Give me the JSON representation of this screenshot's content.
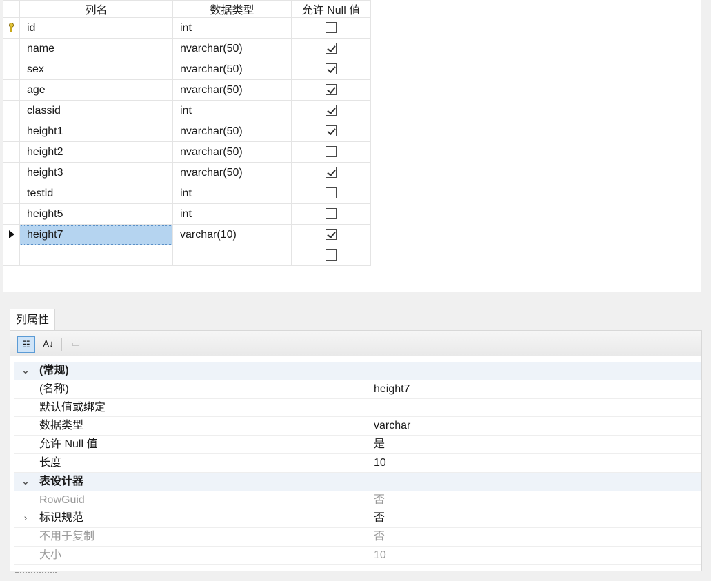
{
  "grid": {
    "headers": {
      "name": "列名",
      "type": "数据类型",
      "null": "允许 Null 值"
    },
    "rows": [
      {
        "name": "id",
        "type": "int",
        "allow_null": false,
        "pk": true
      },
      {
        "name": "name",
        "type": "nvarchar(50)",
        "allow_null": true
      },
      {
        "name": "sex",
        "type": "nvarchar(50)",
        "allow_null": true
      },
      {
        "name": "age",
        "type": "nvarchar(50)",
        "allow_null": true
      },
      {
        "name": "classid",
        "type": "int",
        "allow_null": true
      },
      {
        "name": "height1",
        "type": "nvarchar(50)",
        "allow_null": true
      },
      {
        "name": "height2",
        "type": "nvarchar(50)",
        "allow_null": false
      },
      {
        "name": "height3",
        "type": "nvarchar(50)",
        "allow_null": true
      },
      {
        "name": "testid",
        "type": "int",
        "allow_null": false
      },
      {
        "name": "height5",
        "type": "int",
        "allow_null": false
      },
      {
        "name": "height7",
        "type": "varchar(10)",
        "allow_null": true,
        "current": true
      },
      {
        "name": "",
        "type": "",
        "allow_null": false
      }
    ]
  },
  "props": {
    "tab_label": "列属性",
    "toolbar": {
      "categorized_icon": "categorized-icon",
      "alpha_icon": "sort-az-icon",
      "pages_icon": "property-pages-icon"
    },
    "general": {
      "header": "(常规)",
      "rows": [
        {
          "label": "(名称)",
          "value": "height7"
        },
        {
          "label": "默认值或绑定",
          "value": ""
        },
        {
          "label": "数据类型",
          "value": "varchar"
        },
        {
          "label": "允许 Null 值",
          "value": "是"
        },
        {
          "label": "长度",
          "value": "10"
        }
      ]
    },
    "designer": {
      "header": "表设计器",
      "rows": [
        {
          "label": "RowGuid",
          "value": "否",
          "disabled": true
        },
        {
          "label": "标识规范",
          "value": "否",
          "expandable": true
        },
        {
          "label": "不用于复制",
          "value": "否",
          "disabled": true
        },
        {
          "label": "大小",
          "value": "10",
          "disabled": true
        }
      ]
    }
  },
  "colors": {
    "selection": "#b5d4f0",
    "panel_bg": "#f0f0f0",
    "category_bg": "#eef3f9"
  }
}
